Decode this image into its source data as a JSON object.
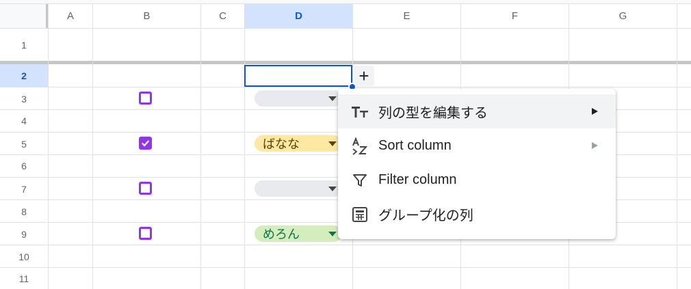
{
  "columns": [
    "A",
    "B",
    "C",
    "D",
    "E",
    "F",
    "G"
  ],
  "rows": [
    "1",
    "2",
    "3",
    "4",
    "5",
    "6",
    "7",
    "8",
    "9",
    "10",
    "11"
  ],
  "selected_column": "D",
  "selected_row": "2",
  "colors": {
    "accent": "#0b57d0",
    "selection_header_bg": "#d3e3fd",
    "checkbox": "#9334e6"
  },
  "checkboxes": [
    {
      "row": "3",
      "checked": false
    },
    {
      "row": "5",
      "checked": true
    },
    {
      "row": "7",
      "checked": false
    },
    {
      "row": "9",
      "checked": false
    }
  ],
  "chips": [
    {
      "row": "3",
      "label": "",
      "color": "#e8eaed",
      "text_color": "#202124"
    },
    {
      "row": "5",
      "label": "ばなな",
      "color": "#ffe8a3",
      "text_color": "#594300"
    },
    {
      "row": "7",
      "label": "",
      "color": "#e8eaed",
      "text_color": "#202124"
    },
    {
      "row": "9",
      "label": "めろん",
      "color": "#d4edbc",
      "text_color": "#11734b"
    }
  ],
  "add_button_label": "+",
  "context_menu": {
    "items": [
      {
        "label": "列の型を編集する",
        "icon": "text-type-icon",
        "submenu": true,
        "highlighted": true
      },
      {
        "label": "Sort column",
        "icon": "sort-az-icon",
        "submenu": true,
        "highlighted": false
      },
      {
        "label": "Filter column",
        "icon": "filter-icon",
        "submenu": false,
        "highlighted": false
      },
      {
        "label": "グループ化の列",
        "icon": "group-table-icon",
        "submenu": false,
        "highlighted": false
      }
    ]
  }
}
